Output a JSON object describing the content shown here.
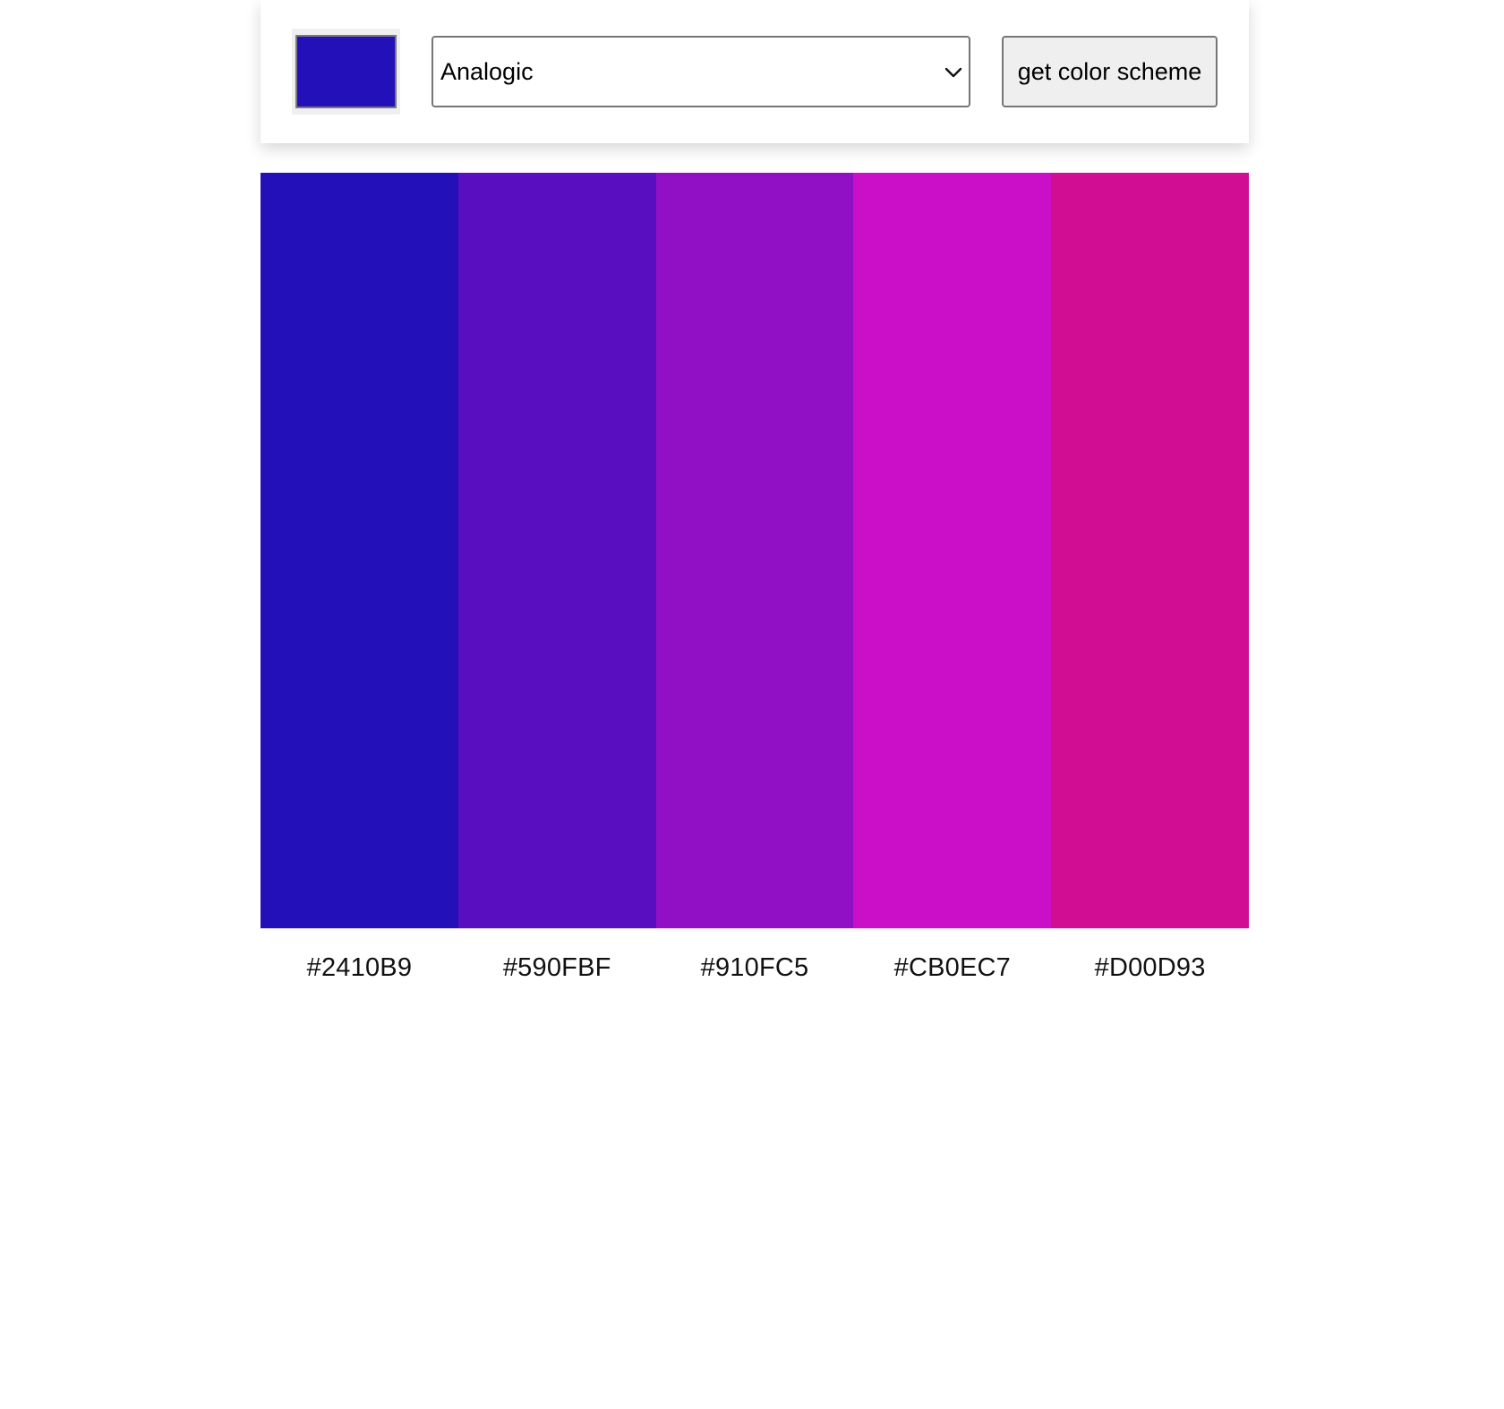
{
  "seed_color": "#2410B9",
  "scheme_select": {
    "selected": "Analogic"
  },
  "get_scheme_button": {
    "label": "get color scheme"
  },
  "palette": [
    {
      "hex": "#2410B9",
      "color": "#2410B9"
    },
    {
      "hex": "#590FBF",
      "color": "#590FBF"
    },
    {
      "hex": "#910FC5",
      "color": "#910FC5"
    },
    {
      "hex": "#CB0EC7",
      "color": "#CB0EC7"
    },
    {
      "hex": "#D00D93",
      "color": "#D00D93"
    }
  ],
  "icons": {
    "dropdown": "chevron-down-icon"
  }
}
